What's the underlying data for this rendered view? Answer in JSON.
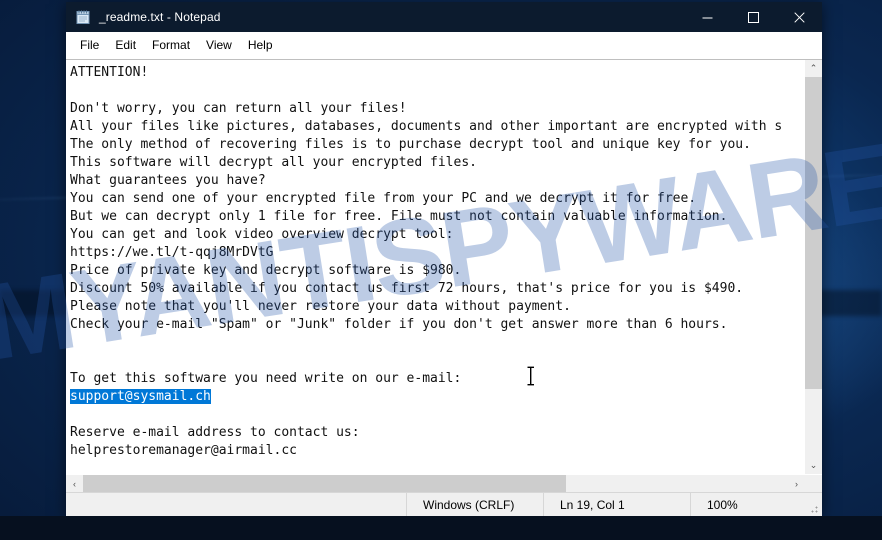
{
  "window": {
    "title": "_readme.txt - Notepad",
    "app_icon": "notepad-icon",
    "controls": {
      "minimize": "—",
      "maximize": "☐",
      "close": "✕"
    }
  },
  "menu": {
    "items": [
      {
        "label": "File"
      },
      {
        "label": "Edit"
      },
      {
        "label": "Format"
      },
      {
        "label": "View"
      },
      {
        "label": "Help"
      }
    ]
  },
  "document": {
    "lines": [
      "ATTENTION!",
      "",
      "Don't worry, you can return all your files!",
      "All your files like pictures, databases, documents and other important are encrypted with s",
      "The only method of recovering files is to purchase decrypt tool and unique key for you.",
      "This software will decrypt all your encrypted files.",
      "What guarantees you have?",
      "You can send one of your encrypted file from your PC and we decrypt it for free.",
      "But we can decrypt only 1 file for free. File must not contain valuable information.",
      "You can get and look video overview decrypt tool:",
      "https://we.tl/t-qqj8MrDVtG",
      "Price of private key and decrypt software is $980.",
      "Discount 50% available if you contact us first 72 hours, that's price for you is $490.",
      "Please note that you'll never restore your data without payment.",
      "Check your e-mail \"Spam\" or \"Junk\" folder if you don't get answer more than 6 hours.",
      "",
      "",
      "To get this software you need write on our e-mail:",
      "support@sysmail.ch",
      "",
      "Reserve e-mail address to contact us:",
      "helprestoremanager@airmail.cc"
    ],
    "selected_line_index": 18,
    "selected_text": "support@sysmail.ch"
  },
  "statusbar": {
    "encoding": "Windows (CRLF)",
    "position": "Ln 19, Col 1",
    "zoom": "100%"
  },
  "scrollbars": {
    "vertical_up": "⌃",
    "vertical_down": "⌄",
    "horizontal_left": "‹",
    "horizontal_right": "›"
  },
  "desktop": {
    "watermark": "MYANTISPYWARE.COM"
  },
  "colors": {
    "titlebar_bg": "#0c1b2e",
    "selection_bg": "#0078d7",
    "window_bg": "#ffffff",
    "chrome_bg": "#f0f0f0",
    "scroll_thumb": "#cdcdcd",
    "desktop_blue": "#0f3c72"
  }
}
